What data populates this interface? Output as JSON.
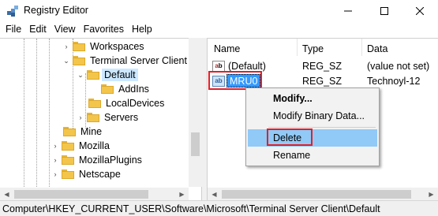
{
  "window": {
    "title": "Registry Editor",
    "minimize_glyph": "—",
    "maximize_glyph": "☐",
    "close_glyph": "✕"
  },
  "menu": [
    "File",
    "Edit",
    "View",
    "Favorites",
    "Help"
  ],
  "tree": [
    {
      "label": "Workspaces",
      "expander": "›",
      "selected": false
    },
    {
      "label": "Terminal Server Client",
      "expander": "⌄",
      "selected": false
    },
    {
      "label": "Default",
      "expander": "⌄",
      "selected": true
    },
    {
      "label": "AddIns",
      "expander": "",
      "selected": false
    },
    {
      "label": "LocalDevices",
      "expander": "",
      "selected": false
    },
    {
      "label": "Servers",
      "expander": "›",
      "selected": false
    },
    {
      "label": "Mine",
      "expander": "",
      "selected": false
    },
    {
      "label": "Mozilla",
      "expander": "›",
      "selected": false
    },
    {
      "label": "MozillaPlugins",
      "expander": "›",
      "selected": false
    },
    {
      "label": "Netscape",
      "expander": "›",
      "selected": false
    }
  ],
  "list": {
    "columns": [
      "Name",
      "Type",
      "Data"
    ],
    "rows": [
      {
        "name": "(Default)",
        "type": "REG_SZ",
        "data": "(value not set)"
      },
      {
        "name": "MRU0",
        "type": "REG_SZ",
        "data": "Technoyl-12"
      }
    ],
    "icon_text": "ab"
  },
  "context_menu": {
    "items": [
      {
        "label": "Modify...",
        "bold": true
      },
      {
        "label": "Modify Binary Data...",
        "bold": false
      },
      {
        "label": "Delete",
        "bold": false
      },
      {
        "label": "Rename",
        "bold": false
      }
    ]
  },
  "scroll": {
    "left_arrow": "◀",
    "right_arrow": "▶"
  },
  "status": {
    "path": "Computer\\HKEY_CURRENT_USER\\Software\\Microsoft\\Terminal Server Client\\Default"
  },
  "colors": {
    "selection": "#3399ff",
    "menu_hover": "#91c9f7",
    "highlight_box": "#e0202a",
    "folder": "#f3c54b"
  }
}
